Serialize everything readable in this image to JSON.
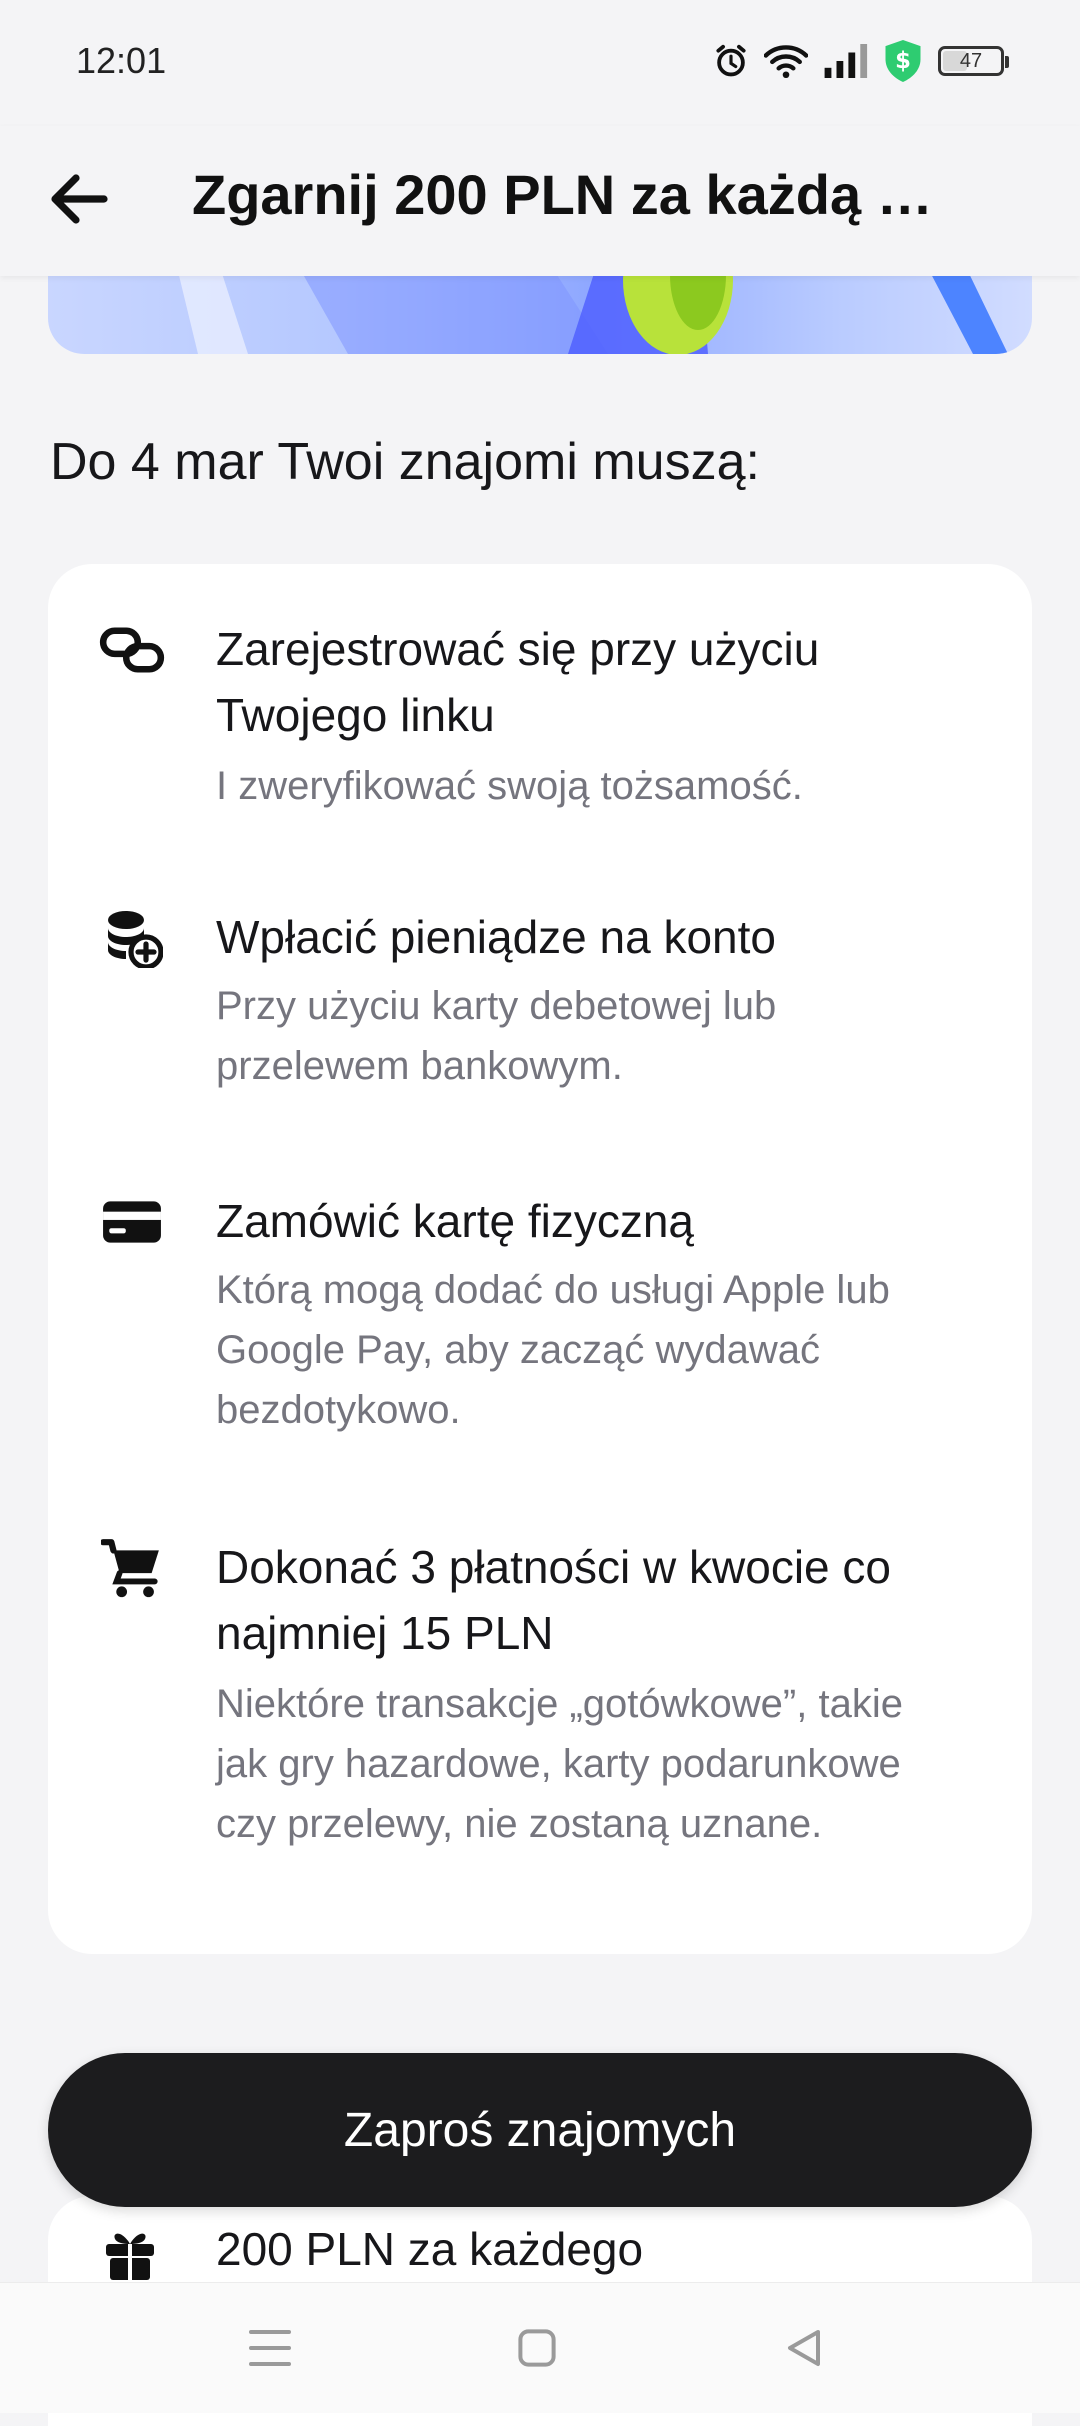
{
  "status_bar": {
    "time": "12:01",
    "battery_level": "47",
    "battery_fraction": 0.47,
    "icons": [
      "alarm-icon",
      "wifi-icon",
      "signal-icon",
      "security-shield-icon",
      "battery-icon"
    ]
  },
  "header": {
    "title": "Zgarnij 200 PLN za każdą …",
    "back_icon": "arrow-left-icon"
  },
  "section_heading": "Do 4 mar Twoi znajomi muszą:",
  "requirements": [
    {
      "icon": "link-icon",
      "title": "Zarejestrować się przy użyciu Twojego linku",
      "description": "I zweryfikować swoją tożsamość."
    },
    {
      "icon": "coins-add-icon",
      "title": "Wpłacić pieniądze na konto",
      "description": "Przy użyciu karty debetowej lub przelewem bankowym."
    },
    {
      "icon": "card-icon",
      "title": "Zamówić kartę fizyczną",
      "description": "Którą mogą dodać do usługi Apple lub Google Pay, aby zacząć wydawać bezdotykowo."
    },
    {
      "icon": "cart-icon",
      "title": "Dokonać 3 płatności w kwocie co najmniej 15 PLN",
      "description": "Niektóre transakcje „gotówkowe”, takie jak gry hazardowe, karty podarunkowe czy przelewy, nie zostaną uznane."
    }
  ],
  "reward": {
    "icon": "gift-icon",
    "title": "200 PLN za każdego"
  },
  "cta": {
    "label": "Zaproś znajomych"
  },
  "nav_bar": {
    "icons": [
      "menu-icon",
      "home-square-icon",
      "back-triangle-icon"
    ]
  },
  "colors": {
    "background": "#f4f4f6",
    "card": "#ffffff",
    "cta_background": "#1c1c1e",
    "secondary_text": "#75757e",
    "shield_green": "#2ecc71"
  }
}
